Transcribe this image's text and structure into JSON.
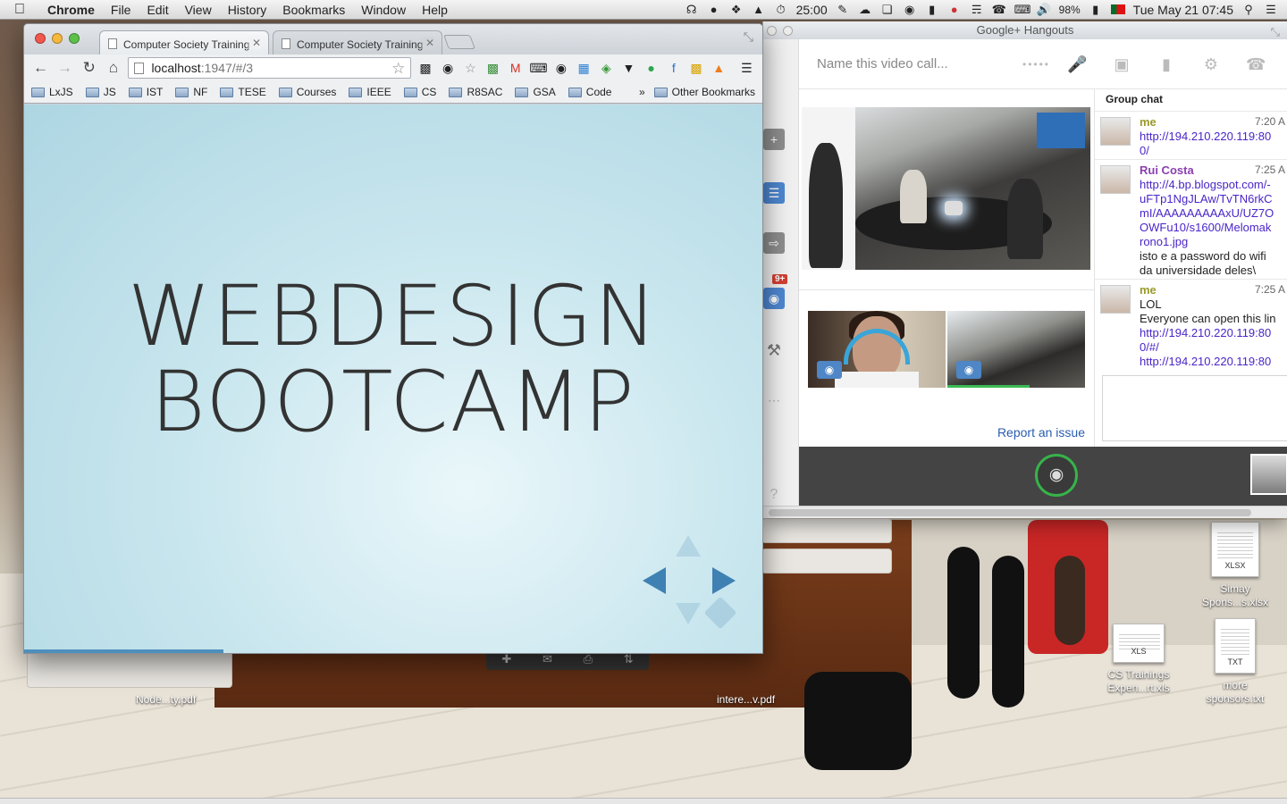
{
  "menubar": {
    "app_name": "Chrome",
    "menus": [
      "File",
      "Edit",
      "View",
      "History",
      "Bookmarks",
      "Window",
      "Help"
    ],
    "timer": "25:00",
    "battery": "98%",
    "datetime": "Tue May 21  07:45"
  },
  "browser": {
    "tabs": [
      {
        "title": "Computer Society Training"
      },
      {
        "title": "Computer Society Training"
      }
    ],
    "url_host": "localhost",
    "url_path": ":1947/#/3",
    "bookmarks": [
      "LxJS",
      "JS",
      "IST",
      "NF",
      "TESE",
      "Courses",
      "IEEE",
      "CS",
      "R8SAC",
      "GSA",
      "Code"
    ],
    "bookmarks_more": "»",
    "other_bookmarks": "Other Bookmarks",
    "slide": {
      "line1": "WEBDESIGN",
      "line2": "BOOTCAMP",
      "progress": 0.27
    }
  },
  "hangouts": {
    "window_title": "Google+ Hangouts",
    "call_name_placeholder": "Name this video call...",
    "badge": "9+",
    "report_link": "Report an issue",
    "group_chat_label": "Group chat",
    "messages": [
      {
        "name": "me",
        "time": "7:20 A",
        "lines": [
          "http://194.210.220.119:80",
          "0/"
        ]
      },
      {
        "name": "Rui Costa",
        "time": "7:25 A",
        "lines": [
          "http://4.bp.blogspot.com/-",
          "uFTp1NgJLAw/TvTN6rkC",
          "mI/AAAAAAAAAxU/UZ7O",
          "OWFu10/s1600/Melomak",
          "rono1.jpg",
          "isto e a password do wifi",
          "da universidade deles\\"
        ]
      },
      {
        "name": "me",
        "time": "7:25 A",
        "lines": [
          "LOL",
          "Everyone can open this lin",
          "http://194.210.220.119:80",
          "0/#/",
          "http://194.210.220.119:80"
        ]
      }
    ]
  },
  "desktop": {
    "files": [
      {
        "line1": "Simay",
        "line2": "Spons...s.xlsx",
        "ext": "XLSX"
      },
      {
        "line1": "CS Trainings",
        "line2": "Expen...rt.xls",
        "ext": "XLS"
      },
      {
        "line1": "more",
        "line2": "sponsors.txt",
        "ext": "TXT"
      }
    ],
    "partial_labels": [
      "Node...ty.pdf",
      "intere...v.pdf"
    ]
  },
  "colors": {
    "slide_text": "#333333",
    "nav_arrows": "#3f81b3",
    "hangouts_link": "#4a25c8",
    "me_name": "#9a9a2a",
    "rui_name": "#8a3fb0"
  }
}
